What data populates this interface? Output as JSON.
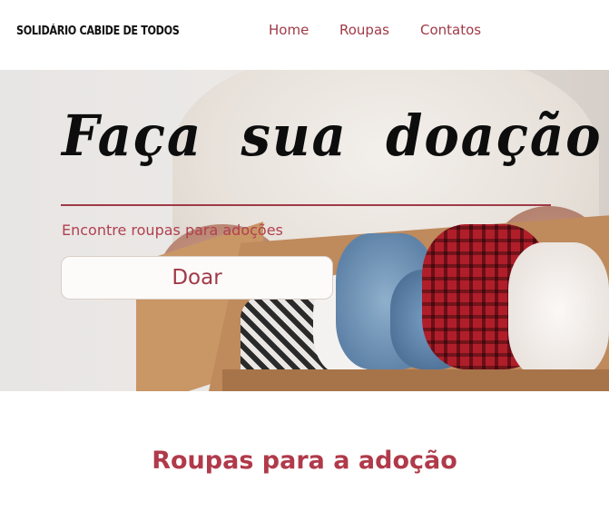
{
  "header": {
    "logo_text": "SOLIDÁRIO CABIDE DE TODOS",
    "nav": [
      {
        "label": "Home"
      },
      {
        "label": "Roupas"
      },
      {
        "label": "Contatos"
      }
    ]
  },
  "hero": {
    "title": "Faça sua doação",
    "subtitle": "Encontre roupas para adoções",
    "button_label": "Doar",
    "image": "person-holding-donation-box-with-clothes"
  },
  "section": {
    "title": "Roupas para a adoção"
  },
  "colors": {
    "accent": "#a03a47",
    "section_title": "#b03a4a",
    "title_text": "#0d0d0d"
  }
}
